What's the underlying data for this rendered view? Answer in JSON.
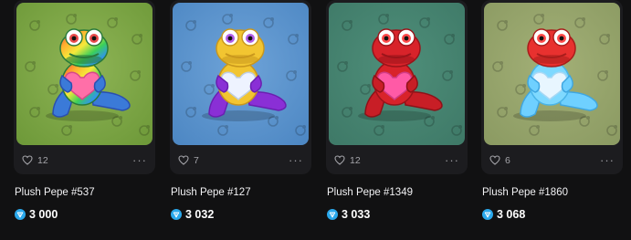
{
  "items": [
    {
      "name": "Plush Pepe #537",
      "likes": "12",
      "price": "3 000",
      "background": "#6f9a3a",
      "background_light": "#8fb556",
      "variant": "rainbow",
      "icons": {
        "like": "heart-icon",
        "more": "more-dots-icon",
        "currency": "ton-diamond-icon"
      }
    },
    {
      "name": "Plush Pepe #127",
      "likes": "7",
      "price": "3 032",
      "background": "#4e88c4",
      "background_light": "#6ea3d8",
      "variant": "gold-purple",
      "icons": {
        "like": "heart-icon",
        "more": "more-dots-icon",
        "currency": "ton-diamond-icon"
      }
    },
    {
      "name": "Plush Pepe #1349",
      "likes": "12",
      "price": "3 033",
      "background": "#3f7a68",
      "background_light": "#4f8f7a",
      "variant": "red",
      "icons": {
        "like": "heart-icon",
        "more": "more-dots-icon",
        "currency": "ton-diamond-icon"
      }
    },
    {
      "name": "Plush Pepe #1860",
      "likes": "6",
      "price": "3 068",
      "background": "#8c9b63",
      "background_light": "#a3b077",
      "variant": "red-ice",
      "icons": {
        "like": "heart-icon",
        "more": "more-dots-icon",
        "currency": "ton-diamond-icon"
      }
    }
  ],
  "more_label": "···",
  "colors": {
    "page_bg": "#111112",
    "card_bg": "#1c1c1f",
    "muted_text": "#a4a4a9",
    "ton_blue": "#2aa8ec"
  }
}
